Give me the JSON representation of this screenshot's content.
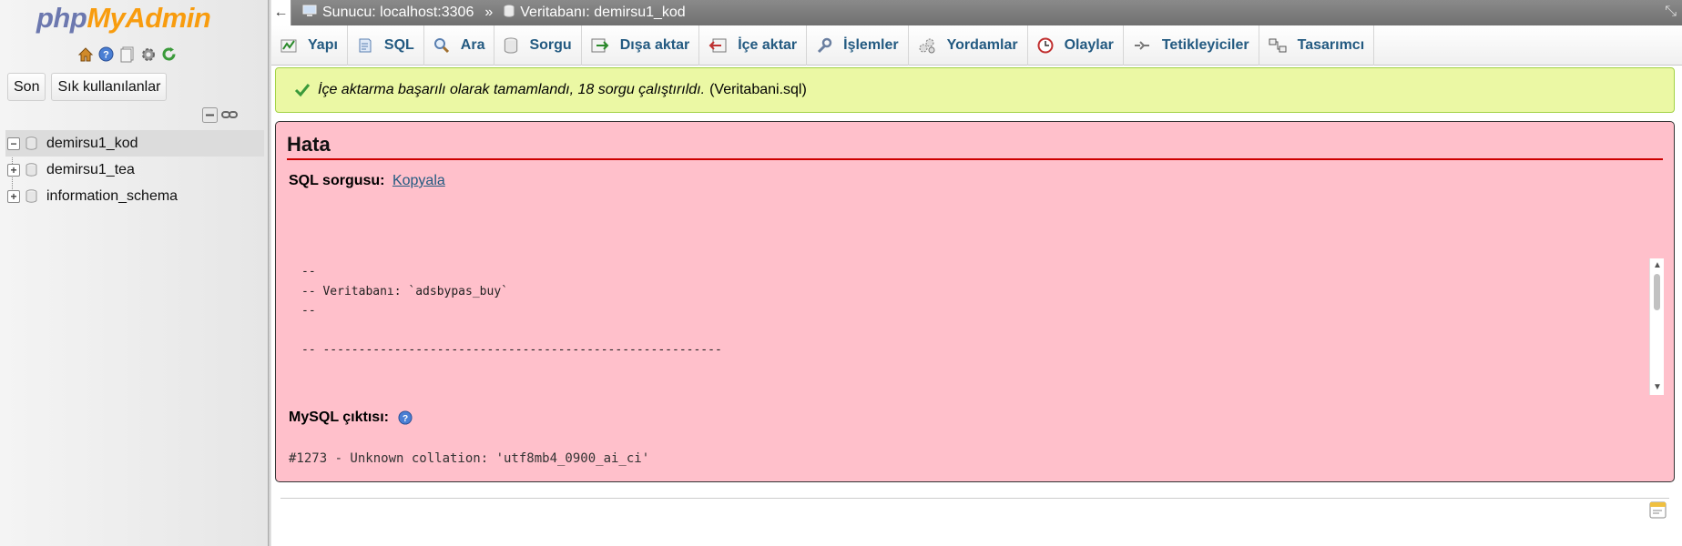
{
  "left": {
    "logo_php": "php",
    "logo_myadmin": "MyAdmin",
    "quick_icons": [
      "home-icon",
      "help-icon",
      "docs-icon",
      "settings-icon",
      "reload-icon"
    ],
    "buttons": {
      "recent": "Son",
      "favorites": "Sık kullanılanlar"
    },
    "databases": [
      {
        "name": "demirsu1_kod",
        "expander": "−",
        "active": true
      },
      {
        "name": "demirsu1_tea",
        "expander": "+",
        "active": false
      },
      {
        "name": "information_schema",
        "expander": "+",
        "active": false
      }
    ]
  },
  "topbar": {
    "server": "Sunucu: localhost:3306",
    "separator": "»",
    "database": "Veritabanı: demirsu1_kod"
  },
  "tabs": [
    {
      "label": "Yapı",
      "icon": "structure-icon"
    },
    {
      "label": "SQL",
      "icon": "sql-icon"
    },
    {
      "label": "Ara",
      "icon": "search-icon"
    },
    {
      "label": "Sorgu",
      "icon": "query-icon"
    },
    {
      "label": "Dışa aktar",
      "icon": "export-icon"
    },
    {
      "label": "İçe aktar",
      "icon": "import-icon"
    },
    {
      "label": "İşlemler",
      "icon": "operations-icon"
    },
    {
      "label": "Yordamlar",
      "icon": "routines-icon"
    },
    {
      "label": "Olaylar",
      "icon": "events-icon"
    },
    {
      "label": "Tetikleyiciler",
      "icon": "triggers-icon"
    },
    {
      "label": "Tasarımcı",
      "icon": "designer-icon"
    }
  ],
  "success": {
    "text": "İçe aktarma başarılı olarak tamamlandı, 18 sorgu çalıştırıldı.",
    "file": "(Veritabani.sql)"
  },
  "error": {
    "title": "Hata",
    "sql_label": "SQL sorgusu:",
    "copy_link": "Kopyala",
    "sql_text": "--\n-- Veritabanı: `adsbypas_buy`\n--\n\n-- --------------------------------------------------------",
    "output_label": "MySQL çıktısı:",
    "error_message": "#1273 - Unknown collation: 'utf8mb4_0900_ai_ci'"
  },
  "colors": {
    "tab_text": "#235a81",
    "success_bg": "#ebf8a4",
    "error_bg": "#ffc0cb",
    "error_rule": "#cc0000"
  }
}
